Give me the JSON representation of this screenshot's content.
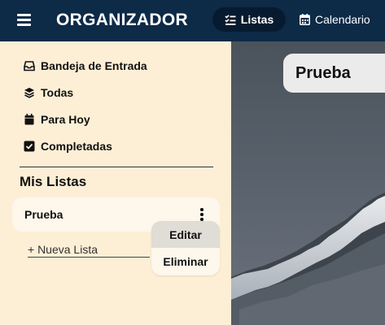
{
  "header": {
    "brand": "ORGANIZADOR",
    "tabs": [
      {
        "label": "Listas",
        "icon": "list-check-icon",
        "active": true
      },
      {
        "label": "Calendario",
        "icon": "calendar-icon",
        "active": false
      }
    ]
  },
  "sidebar": {
    "items": [
      {
        "label": "Bandeja de Entrada",
        "icon": "inbox-icon"
      },
      {
        "label": "Todas",
        "icon": "layers-icon"
      },
      {
        "label": "Para Hoy",
        "icon": "calendar-icon"
      },
      {
        "label": "Completadas",
        "icon": "check-square-icon"
      }
    ],
    "section_title": "Mis Listas",
    "lists": [
      {
        "label": "Prueba"
      }
    ],
    "new_list": "+ Nueva Lista",
    "context_menu": {
      "items": [
        {
          "label": "Editar",
          "hovered": true
        },
        {
          "label": "Eliminar",
          "hovered": false
        }
      ]
    }
  },
  "main": {
    "title": "Prueba"
  },
  "colors": {
    "header_bg": "#0d2a47",
    "active_tab_bg": "#071b30",
    "sidebar_bg": "#fdefd6"
  }
}
